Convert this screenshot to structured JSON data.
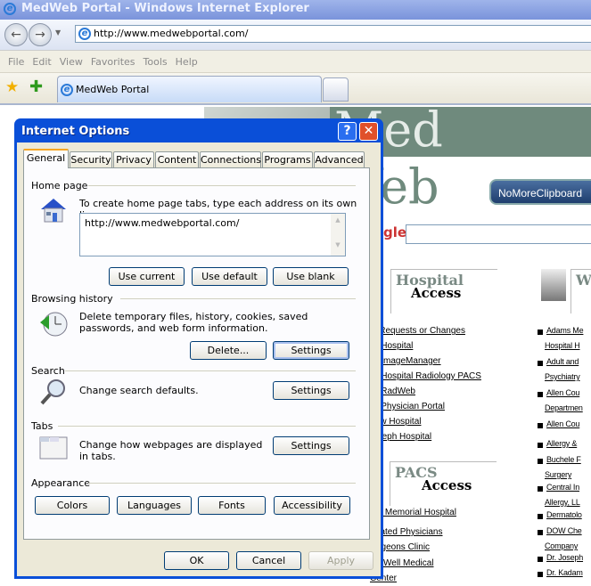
{
  "window": {
    "title": "MedWeb Portal - Windows Internet Explorer"
  },
  "address_bar": {
    "url": "http://www.medwebportal.com/"
  },
  "menu": [
    "File",
    "Edit",
    "View",
    "Favorites",
    "Tools",
    "Help"
  ],
  "browser_tab": {
    "label": "MedWeb Portal"
  },
  "page": {
    "logo_top": "Med",
    "logo_bottom": "Web",
    "nomoreclipboard": "NoMoreClipboard",
    "google": "gle",
    "hospital_access": {
      "line1": "Hospital",
      "line2": "Access"
    },
    "pacs_access": {
      "line1": "PACS",
      "line2": "Access"
    },
    "w_section": "W",
    "hospital_links": [
      "Login Requests or Changes",
      "Lutheran Hospital",
      "Lutheran ImageManager",
      "Lutheran Hospital Radiology PACS",
      "Lutheran RadWeb",
      "Lutheran Physician Portal",
      "Parkview Hospital",
      "St. Joseph Hospital"
    ],
    "pacs_links": [
      "Adams Memorial Hospital",
      "Associated Physicians",
      "Surgeons Clinic",
      "The Well Medical",
      "Center"
    ],
    "right_links": [
      "Adams Me",
      "Hospital H",
      "Adult and",
      "Psychiatry",
      "Allen Cou",
      "Departmen",
      "Allen Cou",
      "Allergy & ",
      "Buchele F",
      "Surgery",
      "Central In",
      "Allergy, LL",
      "Dermatolo",
      "DOW Che",
      "Company",
      "Dr. Joseph",
      "Dr. Kadam"
    ]
  },
  "dialog": {
    "title": "Internet Options",
    "help": "?",
    "close": "✕",
    "tabs": [
      "General",
      "Security",
      "Privacy",
      "Content",
      "Connections",
      "Programs",
      "Advanced"
    ],
    "active_tab": "General",
    "home": {
      "label": "Home page",
      "desc": "To create home page tabs, type each address on its own line.",
      "value": "http://www.medwebportal.com/",
      "use_current": "Use current",
      "use_default": "Use default",
      "use_blank": "Use blank"
    },
    "history": {
      "label": "Browsing history",
      "desc": "Delete temporary files, history, cookies, saved passwords, and web form information.",
      "delete": "Delete...",
      "settings": "Settings"
    },
    "search": {
      "label": "Search",
      "desc": "Change search defaults.",
      "settings": "Settings"
    },
    "tabs_group": {
      "label": "Tabs",
      "desc": "Change how webpages are displayed in tabs.",
      "settings": "Settings"
    },
    "appearance": {
      "label": "Appearance",
      "colors": "Colors",
      "languages": "Languages",
      "fonts": "Fonts",
      "accessibility": "Accessibility"
    },
    "ok": "OK",
    "cancel": "Cancel",
    "apply": "Apply"
  },
  "colors": {
    "titlebar": "#0a4fd8",
    "dialog_bg": "#ece9d8",
    "logo_green": "#6f8a7d"
  }
}
